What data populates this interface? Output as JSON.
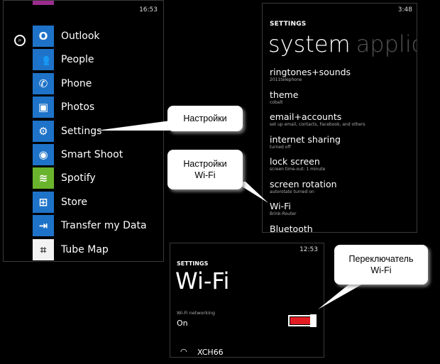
{
  "start_screen": {
    "clock": "16:53",
    "search_icon": "search-icon",
    "apps": [
      {
        "label": "Outlook",
        "icon": "outlook-icon",
        "glyph": "O",
        "color": "#1e73c8"
      },
      {
        "label": "People",
        "icon": "people-icon",
        "glyph": "👥",
        "color": "#1e73c8"
      },
      {
        "label": "Phone",
        "icon": "phone-icon",
        "glyph": "✆",
        "color": "#1e73c8"
      },
      {
        "label": "Photos",
        "icon": "photos-icon",
        "glyph": "▣",
        "color": "#1e73c8"
      },
      {
        "label": "Settings",
        "icon": "gear-icon",
        "glyph": "⚙",
        "color": "#1e73c8"
      },
      {
        "label": "Smart Shoot",
        "icon": "smart-shoot-icon",
        "glyph": "◉",
        "color": "#1e73c8"
      },
      {
        "label": "Spotify",
        "icon": "spotify-icon",
        "glyph": "≋",
        "color": "#6ab42d"
      },
      {
        "label": "Store",
        "icon": "store-icon",
        "glyph": "⊞",
        "color": "#1e73c8"
      },
      {
        "label": "Transfer my Data",
        "icon": "transfer-icon",
        "glyph": "⇥",
        "color": "#1e73c8"
      },
      {
        "label": "Tube Map",
        "icon": "tube-map-icon",
        "glyph": "⌗",
        "color": "#f2f2f2"
      }
    ]
  },
  "settings_screen": {
    "clock": "3:48",
    "header": "SETTINGS",
    "pivot_active": "system",
    "pivot_inactive": "applications",
    "items": [
      {
        "title": "ringtones+sounds",
        "subtitle": "2011telephone"
      },
      {
        "title": "theme",
        "subtitle": "cobalt"
      },
      {
        "title": "email+accounts",
        "subtitle": "set up email, contacts, Facebook, and others"
      },
      {
        "title": "internet sharing",
        "subtitle": "turned off"
      },
      {
        "title": "lock screen",
        "subtitle": "screen time-out: 1 minute"
      },
      {
        "title": "screen rotation",
        "subtitle": "autorotate turned on"
      },
      {
        "title": "Wi-Fi",
        "subtitle": "Brink-Router"
      },
      {
        "title": "Bluetooth",
        "subtitle": ""
      }
    ]
  },
  "wifi_screen": {
    "clock": "12:53",
    "header": "SETTINGS",
    "title": "Wi-Fi",
    "networking_label": "Wi-Fi networking",
    "state": "On",
    "toggle_on": true,
    "toggle_color": "#e31b23",
    "network_name": "XCH66"
  },
  "callouts": {
    "settings": "Настройки",
    "wifi_settings_line1": "Настройки",
    "wifi_settings_line2": "Wi-Fi",
    "wifi_switch_line1": "Переключатель",
    "wifi_switch_line2": "Wi-Fi"
  }
}
